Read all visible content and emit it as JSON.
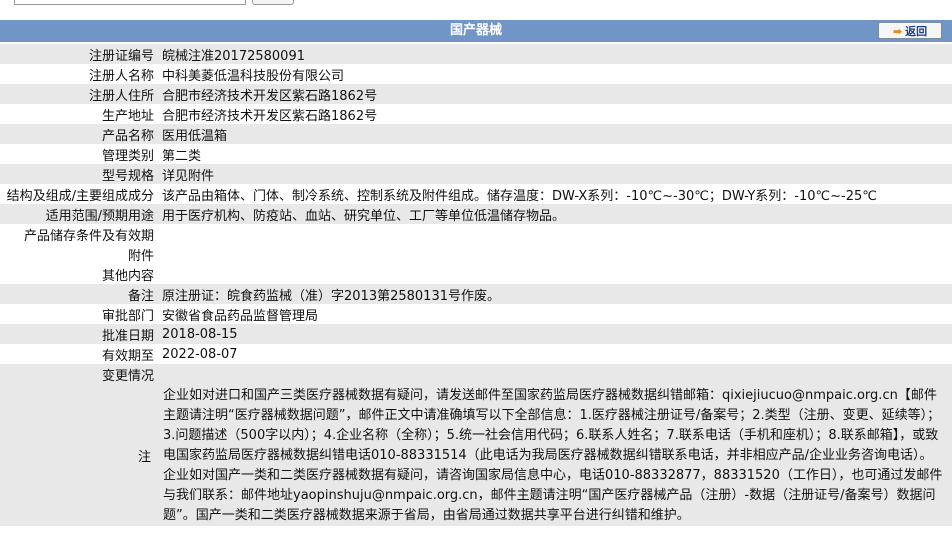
{
  "header": {
    "title": "国产器械",
    "back_label": "返回"
  },
  "rows": [
    {
      "label": "注册证编号",
      "value": "皖械注准20172580091"
    },
    {
      "label": "注册人名称",
      "value": "中科美菱低温科技股份有限公司"
    },
    {
      "label": "注册人住所",
      "value": "合肥市经济技术开发区紫石路1862号"
    },
    {
      "label": "生产地址",
      "value": "合肥市经济技术开发区紫石路1862号"
    },
    {
      "label": "产品名称",
      "value": "医用低温箱"
    },
    {
      "label": "管理类别",
      "value": "第二类"
    },
    {
      "label": "型号规格",
      "value": "详见附件"
    },
    {
      "label": "结构及组成/主要组成成分",
      "value": "该产品由箱体、门体、制冷系统、控制系统及附件组成。储存温度：DW-X系列：-10℃~-30℃；DW-Y系列：-10℃~-25℃"
    },
    {
      "label": "适用范围/预期用途",
      "value": "用于医疗机构、防疫站、血站、研究单位、工厂等单位低温储存物品。"
    },
    {
      "label": "产品储存条件及有效期",
      "value": ""
    },
    {
      "label": "附件",
      "value": ""
    },
    {
      "label": "其他内容",
      "value": ""
    },
    {
      "label": "备注",
      "value": "原注册证：皖食药监械（准）字2013第2580131号作废。"
    },
    {
      "label": "审批部门",
      "value": "安徽省食品药品监督管理局"
    },
    {
      "label": "批准日期",
      "value": "2018-08-15"
    },
    {
      "label": "有效期至",
      "value": "2022-08-07"
    },
    {
      "label": "变更情况",
      "value": ""
    }
  ],
  "note": {
    "label": "注",
    "text": "企业如对进口和国产三类医疗器械数据有疑问，请发送邮件至国家药监局医疗器械数据纠错邮箱：qixiejiucuo@nmpaic.org.cn【邮件主题请注明“医疗器械数据问题”，邮件正文中请准确填写以下全部信息：1.医疗器械注册证号/备案号；2.类型（注册、变更、延续等）；3.问题描述（500字以内）；4.企业名称（全称）；5.统一社会信用代码；6.联系人姓名；7.联系电话（手机和座机）；8.联系邮箱】，或致电国家药监局医疗器械数据纠错电话010-88331514（此电话为我局医疗器械数据纠错联系电话，并非相应产品/企业业务咨询电话）。企业如对国产一类和二类医疗器械数据有疑问，请咨询国家局信息中心，电话010-88332877，88331520（工作日），也可通过发邮件与我们联系：邮件地址yaopinshuju@nmpaic.org.cn，邮件主题请注明“国产医疗器械产品（注册）-数据（注册证号/备案号）数据问题”。国产一类和二类医疗器械数据来源于省局，由省局通过数据共享平台进行纠错和维护。"
  }
}
